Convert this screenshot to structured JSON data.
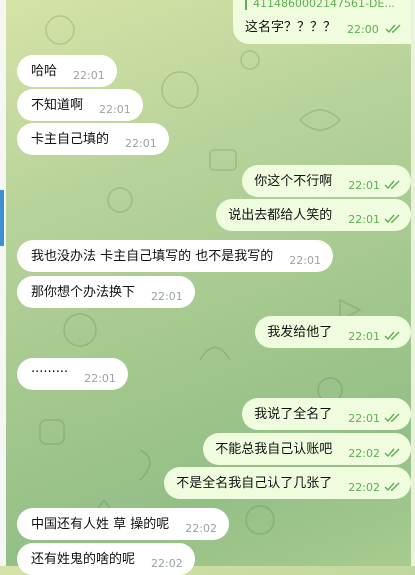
{
  "chat": {
    "top_reply": {
      "quote": "4114860002147561-DE...",
      "text": "这名字？？？？",
      "time": "22:00"
    },
    "messages": [
      {
        "dir": "in",
        "text": "哈哈",
        "time": "22:01"
      },
      {
        "dir": "in",
        "text": "不知道啊",
        "time": "22:01"
      },
      {
        "dir": "in",
        "text": "卡主自己填的",
        "time": "22:01"
      },
      {
        "dir": "out",
        "text": "你这个不行啊",
        "time": "22:01"
      },
      {
        "dir": "out",
        "text": "说出去都给人笑的",
        "time": "22:01"
      },
      {
        "dir": "in",
        "text": "我也没办法  卡主自己填写的   也不是我写的",
        "time": "22:01"
      },
      {
        "dir": "in",
        "text": "那你想个办法换下",
        "time": "22:01"
      },
      {
        "dir": "out",
        "text": "我发给他了",
        "time": "22:01"
      },
      {
        "dir": "in",
        "text": "·········",
        "time": "22:01"
      },
      {
        "dir": "out",
        "text": "我说了全名了",
        "time": "22:01"
      },
      {
        "dir": "out",
        "text": "不能总我自己认账吧",
        "time": "22:02"
      },
      {
        "dir": "out",
        "text": "不是全名我自己认了几张了",
        "time": "22:02"
      },
      {
        "dir": "in",
        "text": "中国还有人姓  草  操的呢",
        "time": "22:02"
      },
      {
        "dir": "in",
        "text": "还有姓鬼的啥的呢",
        "time": "22:02"
      }
    ]
  },
  "colors": {
    "incoming_bubble": "#ffffff",
    "outgoing_bubble": "#effdde",
    "read_ticks": "#5daf4f",
    "sidebar_accent": "#3d8fd6"
  }
}
